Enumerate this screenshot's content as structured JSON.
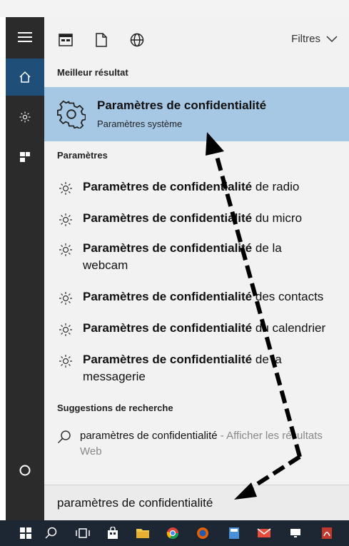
{
  "toolbar": {
    "filters_label": "Filtres"
  },
  "sections": {
    "best_match": "Meilleur résultat",
    "settings": "Paramètres",
    "suggestions": "Suggestions de recherche"
  },
  "best_result": {
    "title": "Paramètres de confidentialité",
    "subtitle": "Paramètres système"
  },
  "settings_items": [
    {
      "bold": "Paramètres de confidentialité",
      "rest": " de radio"
    },
    {
      "bold": "Paramètres de confidentialité",
      "rest": " du micro"
    },
    {
      "bold": "Paramètres de confidentialité",
      "rest": " de la webcam"
    },
    {
      "bold": "Paramètres de confidentialité",
      "rest": " des contacts"
    },
    {
      "bold": "Paramètres de confidentialité",
      "rest": " du calendrier"
    },
    {
      "bold": "Paramètres de confidentialité",
      "rest": " de la messagerie"
    }
  ],
  "suggestion": {
    "query": "paramètres de confidentialité",
    "hint": " - Afficher les résultats Web"
  },
  "search": {
    "value": "paramètres de confidentialité"
  },
  "colors": {
    "accent_rail": "#1f4e79",
    "best_highlight": "#a6c8e4"
  }
}
